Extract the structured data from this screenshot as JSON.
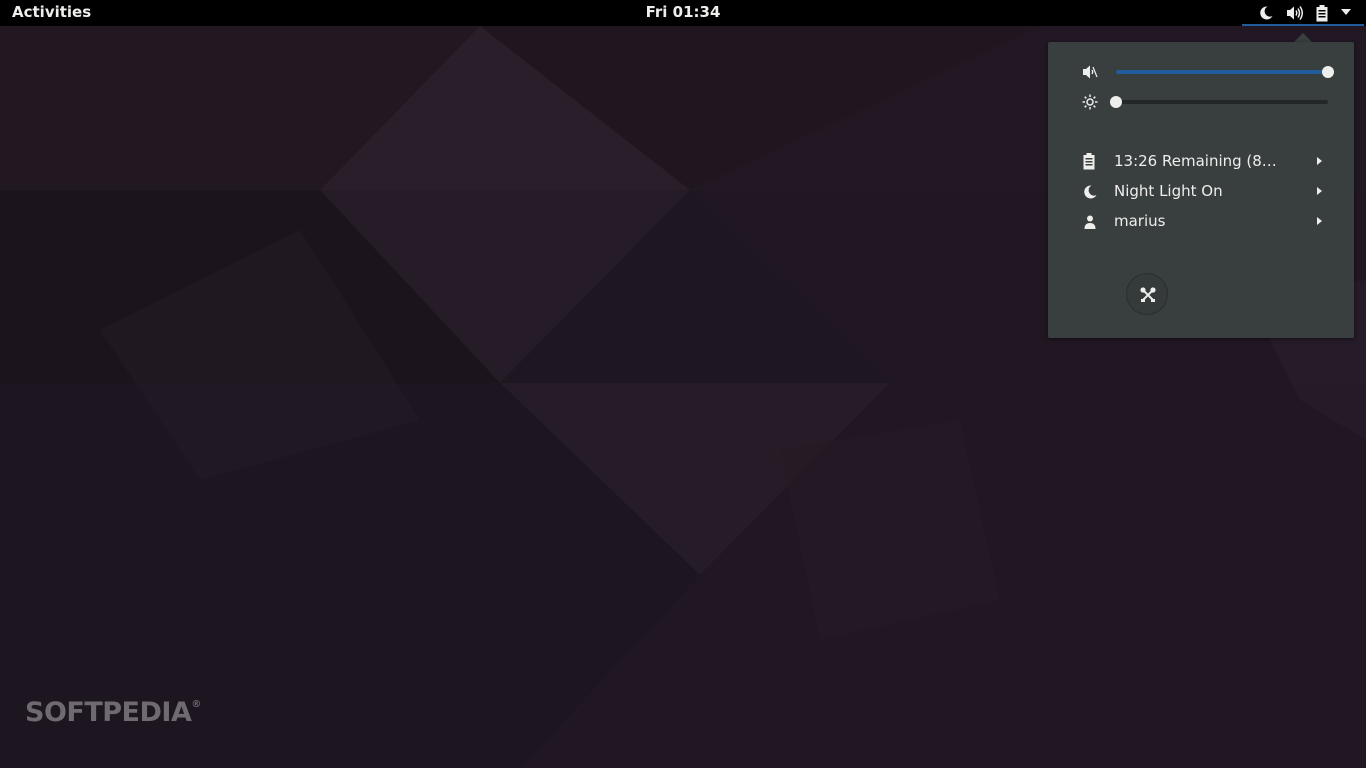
{
  "topbar": {
    "activities_label": "Activities",
    "clock": "Fri 01:34",
    "status_icons": [
      "night-light-icon",
      "volume-icon",
      "battery-icon",
      "dropdown-arrow-icon"
    ]
  },
  "menu": {
    "volume_level": 1.0,
    "brightness_level": 0.0,
    "items": [
      {
        "icon": "battery-icon",
        "label": "13:26 Remaining (8…"
      },
      {
        "icon": "night-light-icon",
        "label": "Night Light On"
      },
      {
        "icon": "user-icon",
        "label": "marius"
      }
    ],
    "settings_icon": "settings-icon"
  },
  "watermark": {
    "text": "SOFTPEDIA"
  },
  "colors": {
    "topbar_bg": "#000000",
    "menu_bg": "#393f3f",
    "accent": "#215d9c",
    "text": "#eeeeec"
  }
}
